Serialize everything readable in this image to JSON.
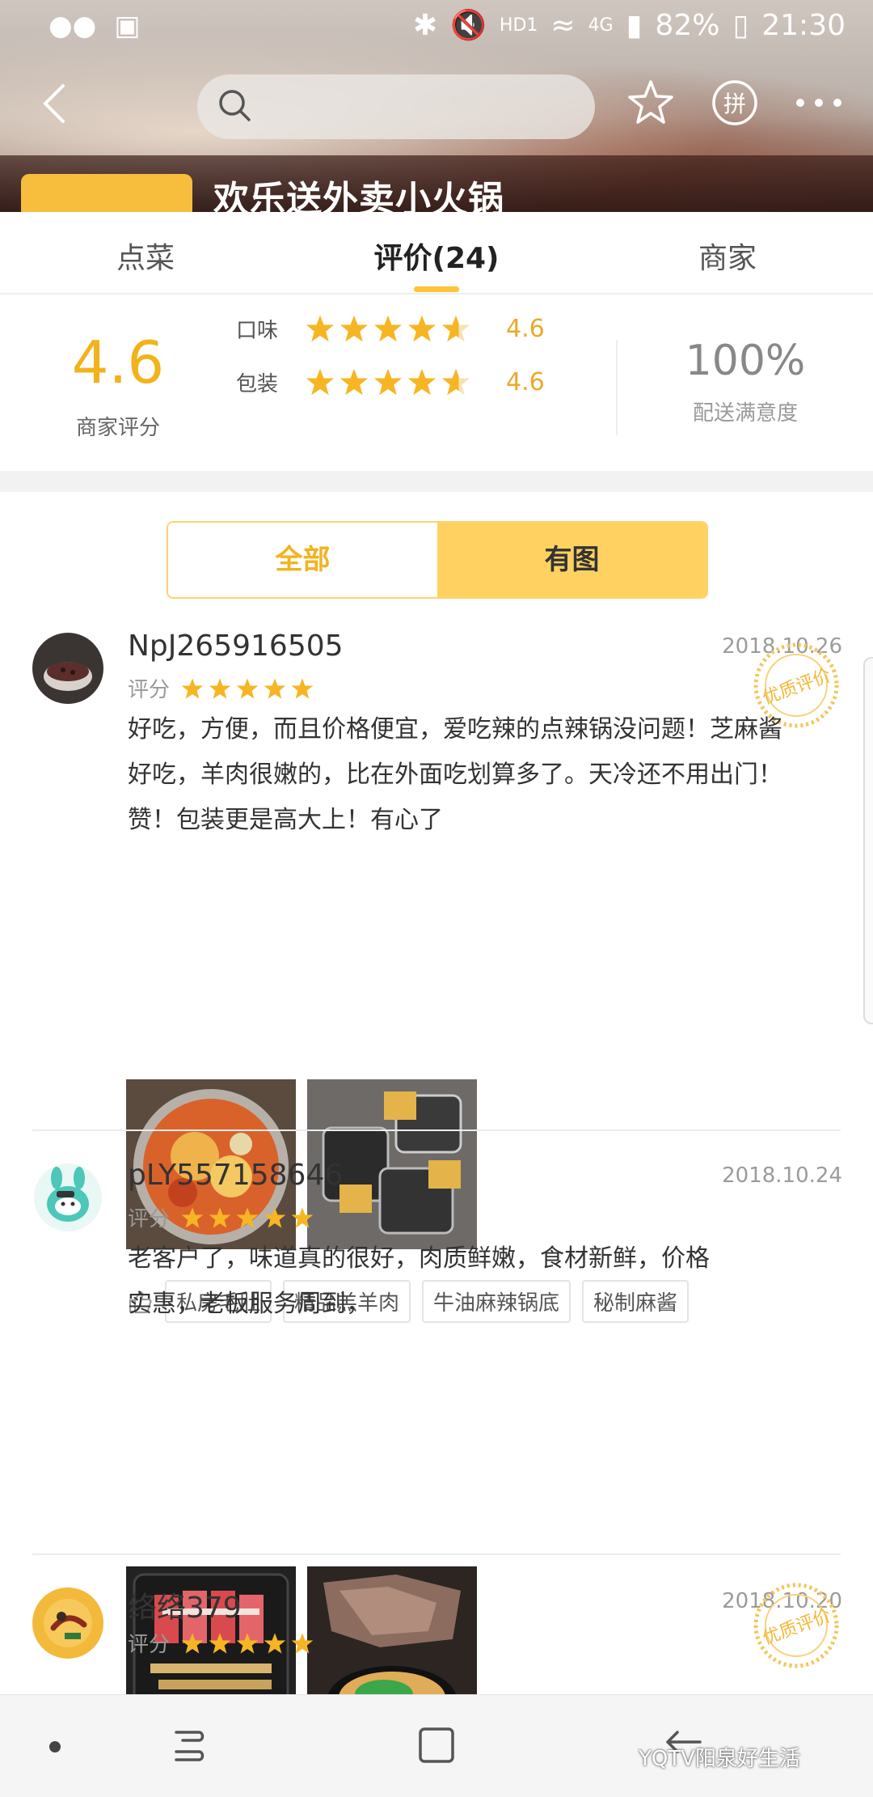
{
  "status_bar": {
    "battery": "82%",
    "time": "21:30",
    "network": "HD1",
    "signal": "4G"
  },
  "header": {
    "search_placeholder": "",
    "store_name": "欢乐送外卖小火锅"
  },
  "tabs": [
    {
      "label": "点菜",
      "active": false
    },
    {
      "label": "评价(24)",
      "active": true
    },
    {
      "label": "商家",
      "active": false
    }
  ],
  "score": {
    "overall": "4.6",
    "overall_label": "商家评分",
    "taste_label": "口味",
    "taste_value": "4.6",
    "taste_rating": 4.6,
    "packaging_label": "包装",
    "packaging_value": "4.6",
    "packaging_rating": 4.6,
    "delivery_value": "100%",
    "delivery_label": "配送满意度"
  },
  "filter": {
    "all_label": "全部",
    "with_photos_label": "有图",
    "selected": "有图"
  },
  "reviews": [
    {
      "username": "NpJ265916505",
      "date": "2018.10.26",
      "score_label": "评分",
      "stars": 5,
      "text_lines": [
        "好吃，方便，而且价格便宜，爱吃辣的点辣锅没问题！芝麻酱",
        "好吃，羊肉很嫩的，比在外面吃划算多了。天冷还不用出门！",
        "赞！包装更是高大上！有心了"
      ],
      "quality_badge": "优质评价",
      "tags": [
        "私房毛肚",
        "精品羔羊肉",
        "牛油麻辣锅底",
        "秘制麻酱"
      ]
    },
    {
      "username": "pLY557158646",
      "date": "2018.10.24",
      "score_label": "评分",
      "stars": 5,
      "text_lines": [
        "老客户了，味道真的很好，肉质鲜嫩，食材新鲜，价格",
        "实惠，老板服务周到，"
      ]
    },
    {
      "username": "络络379",
      "date": "2018.10.20",
      "score_label": "评分",
      "stars": 5,
      "quality_badge": "优质评价"
    }
  ],
  "watermark": "YQTV阳泉好生活",
  "colors": {
    "accent": "#ffc43a",
    "star": "#f6b623",
    "score_text": "#f2b21a"
  }
}
